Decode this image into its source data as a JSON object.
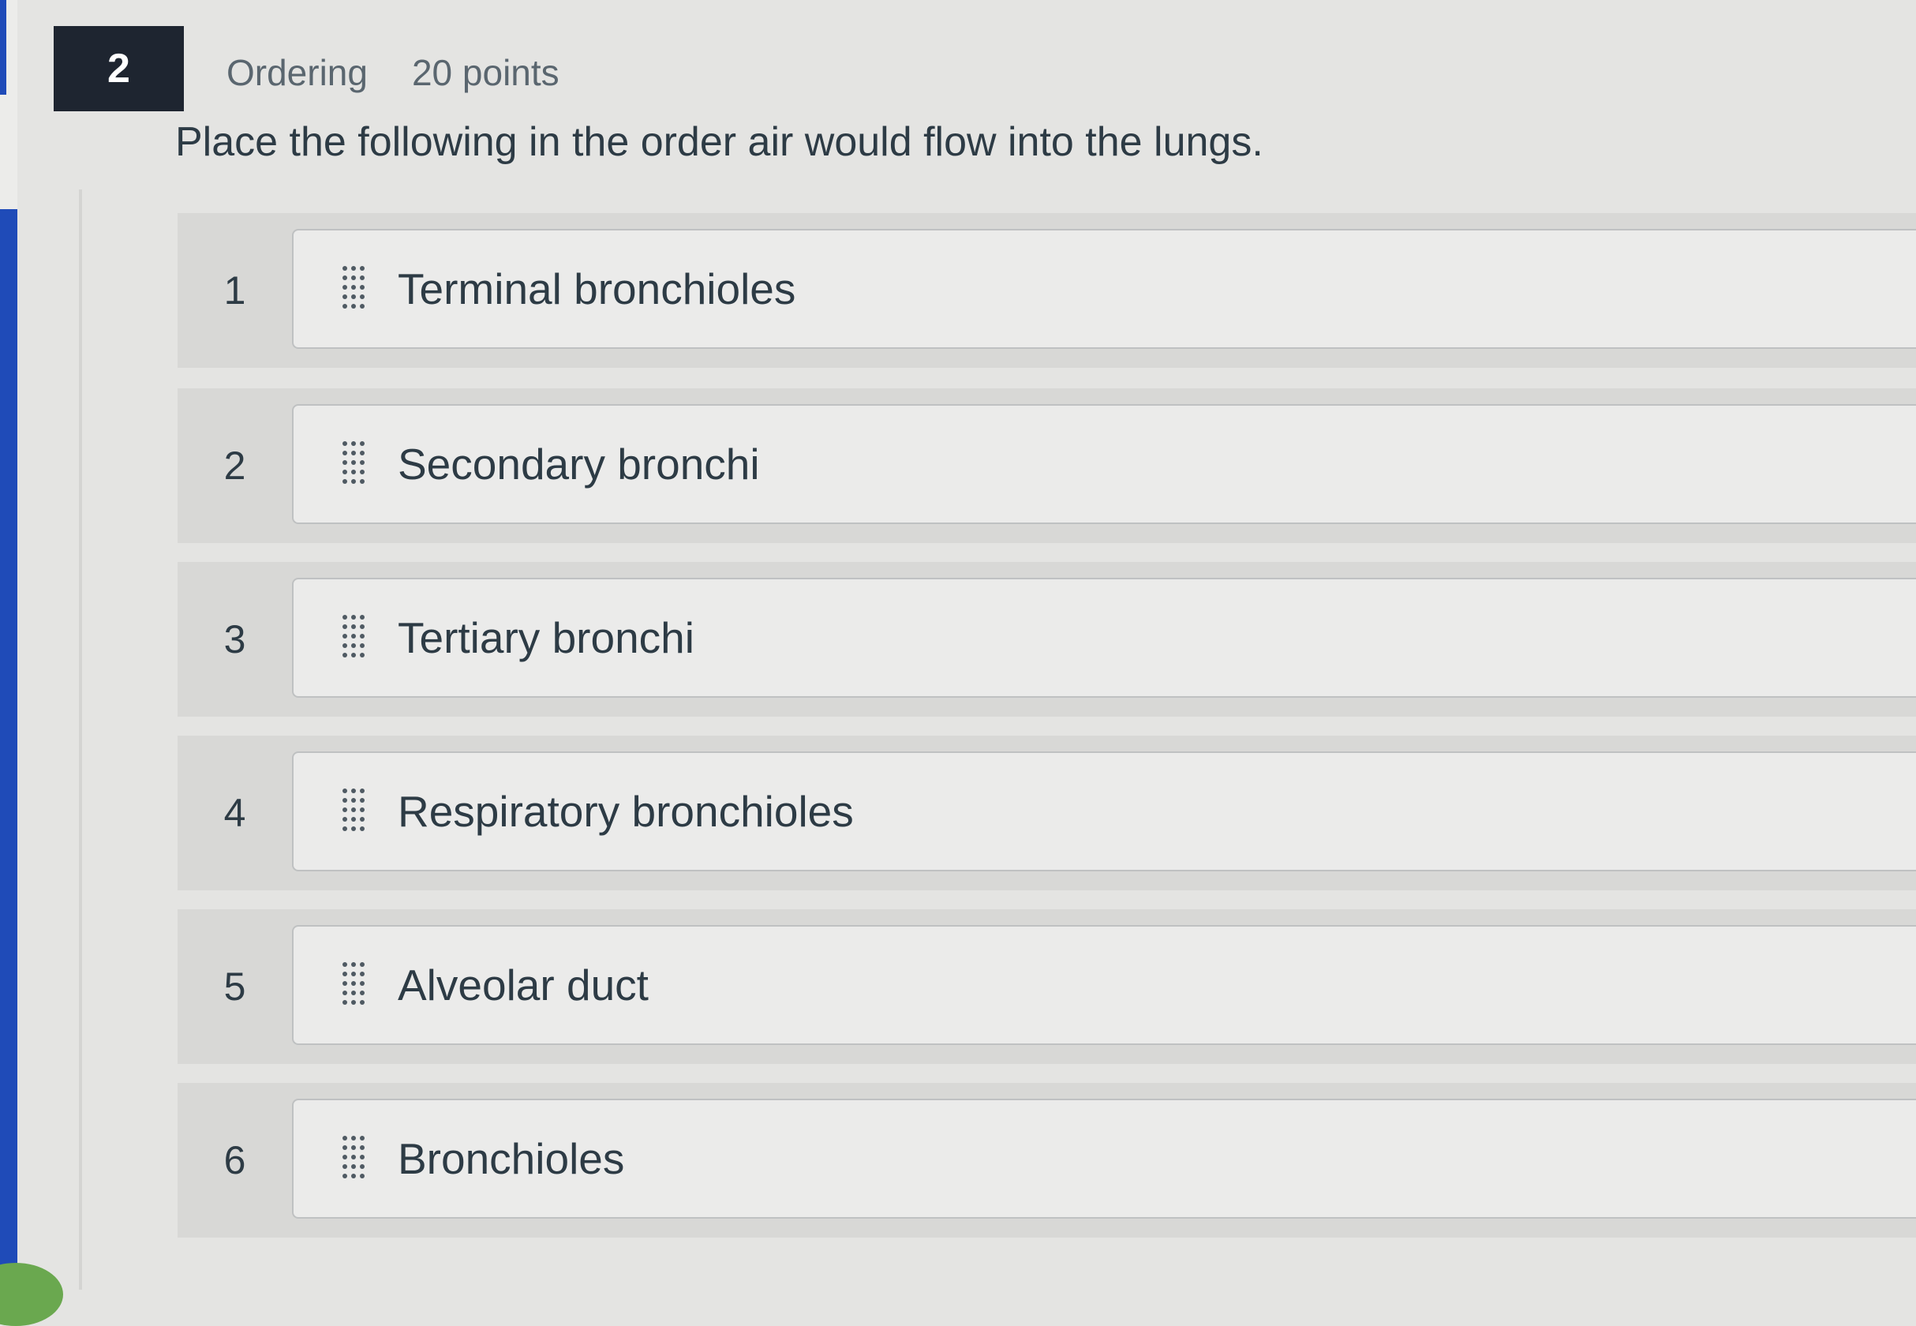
{
  "question": {
    "number": "2",
    "type": "Ordering",
    "points": "20 points",
    "prompt": "Place the following in the order air would flow into the lungs."
  },
  "items": [
    {
      "position": "1",
      "label": "Terminal bronchioles"
    },
    {
      "position": "2",
      "label": "Secondary bronchi"
    },
    {
      "position": "3",
      "label": "Tertiary bronchi"
    },
    {
      "position": "4",
      "label": "Respiratory bronchioles"
    },
    {
      "position": "5",
      "label": "Alveolar duct"
    },
    {
      "position": "6",
      "label": "Bronchioles"
    }
  ],
  "icons": {
    "drag_handle": "drag-handle-icon"
  },
  "colors": {
    "question_badge_bg": "#1e2530",
    "text": "#2d3b45",
    "meta_text": "#5a666f",
    "left_nav_accent": "#1f4bb8"
  }
}
